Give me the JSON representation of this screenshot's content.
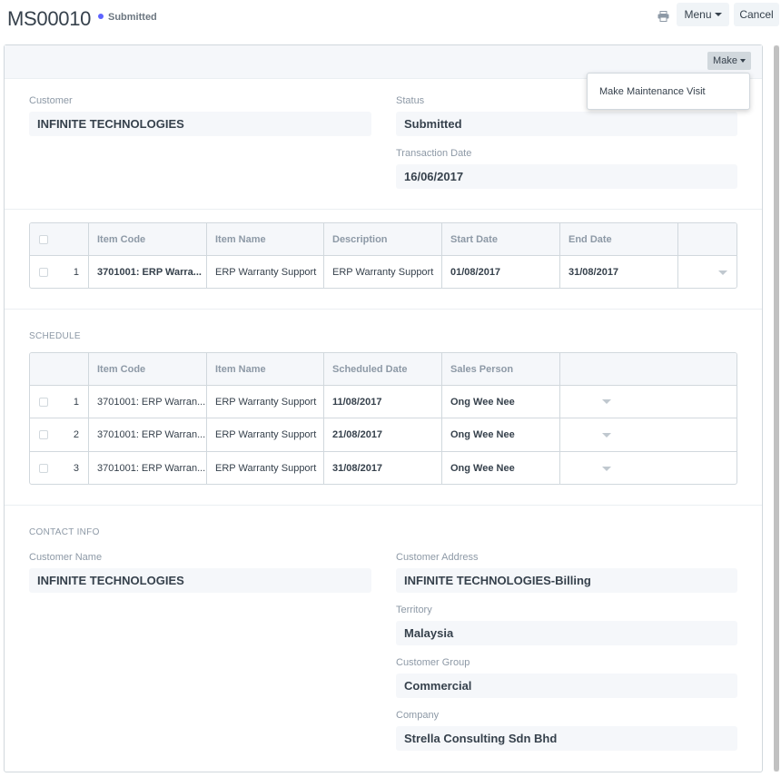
{
  "header": {
    "title": "MS00010",
    "status": "Submitted",
    "menu_label": "Menu",
    "cancel_label": "Cancel",
    "icons": {
      "print": "printer-icon"
    }
  },
  "form_toolbar": {
    "make_label": "Make",
    "make_menu": [
      "Make Maintenance Visit"
    ]
  },
  "details": {
    "customer_label": "Customer",
    "customer": "INFINITE TECHNOLOGIES",
    "status_label": "Status",
    "status": "Submitted",
    "transaction_date_label": "Transaction Date",
    "transaction_date": "16/06/2017"
  },
  "items": {
    "columns": [
      "Item Code",
      "Item Name",
      "Description",
      "Start Date",
      "End Date"
    ],
    "rows": [
      {
        "idx": "1",
        "item_code": "3701001: ERP Warra...",
        "item_name": "ERP Warranty Support",
        "description": "ERP Warranty Support",
        "start_date": "01/08/2017",
        "end_date": "31/08/2017"
      }
    ]
  },
  "schedule": {
    "title": "SCHEDULE",
    "columns": [
      "Item Code",
      "Item Name",
      "Scheduled Date",
      "Sales Person"
    ],
    "rows": [
      {
        "idx": "1",
        "item_code": "3701001: ERP Warran...",
        "item_name": "ERP Warranty Support",
        "scheduled_date": "11/08/2017",
        "sales_person": "Ong Wee Nee"
      },
      {
        "idx": "2",
        "item_code": "3701001: ERP Warran...",
        "item_name": "ERP Warranty Support",
        "scheduled_date": "21/08/2017",
        "sales_person": "Ong Wee Nee"
      },
      {
        "idx": "3",
        "item_code": "3701001: ERP Warran...",
        "item_name": "ERP Warranty Support",
        "scheduled_date": "31/08/2017",
        "sales_person": "Ong Wee Nee"
      }
    ]
  },
  "contact": {
    "title": "CONTACT INFO",
    "customer_name_label": "Customer Name",
    "customer_name": "INFINITE TECHNOLOGIES",
    "customer_address_label": "Customer Address",
    "customer_address": "INFINITE TECHNOLOGIES-Billing",
    "territory_label": "Territory",
    "territory": "Malaysia",
    "customer_group_label": "Customer Group",
    "customer_group": "Commercial",
    "company_label": "Company",
    "company": "Strella Consulting Sdn Bhd"
  },
  "colors": {
    "accent": "#5e64ff",
    "field_bg": "#f5f7fa",
    "border": "#d1d8dd",
    "muted": "#8d99a6"
  }
}
